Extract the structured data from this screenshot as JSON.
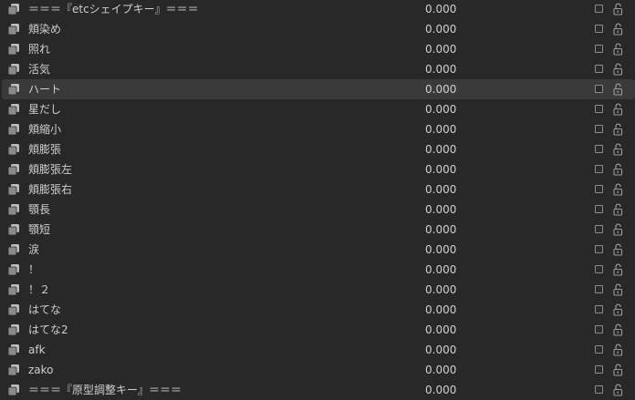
{
  "shape_keys": [
    {
      "name": "＝＝＝『etcシェイプキー』＝＝＝",
      "value": "0.000"
    },
    {
      "name": "頬染め",
      "value": "0.000"
    },
    {
      "name": "照れ",
      "value": "0.000"
    },
    {
      "name": "活気",
      "value": "0.000"
    },
    {
      "name": "ハート",
      "value": "0.000",
      "selected": true
    },
    {
      "name": "星だし",
      "value": "0.000"
    },
    {
      "name": "頬縮小",
      "value": "0.000"
    },
    {
      "name": "頬膨張",
      "value": "0.000"
    },
    {
      "name": "頬膨張左",
      "value": "0.000"
    },
    {
      "name": "頬膨張右",
      "value": "0.000"
    },
    {
      "name": "顎長",
      "value": "0.000"
    },
    {
      "name": "顎短",
      "value": "0.000"
    },
    {
      "name": "涙",
      "value": "0.000"
    },
    {
      "name": "！",
      "value": "0.000"
    },
    {
      "name": "！２",
      "value": "0.000"
    },
    {
      "name": "はてな",
      "value": "0.000"
    },
    {
      "name": "はてな2",
      "value": "0.000"
    },
    {
      "name": "afk",
      "value": "0.000"
    },
    {
      "name": "zako",
      "value": "0.000"
    },
    {
      "name": "＝＝＝『原型調整キー』＝＝＝",
      "value": "0.000"
    }
  ],
  "icons": {
    "row_icon": "shape-key-icon",
    "mute_toggle": "checkbox",
    "lock": "unlocked-padlock-icon"
  }
}
